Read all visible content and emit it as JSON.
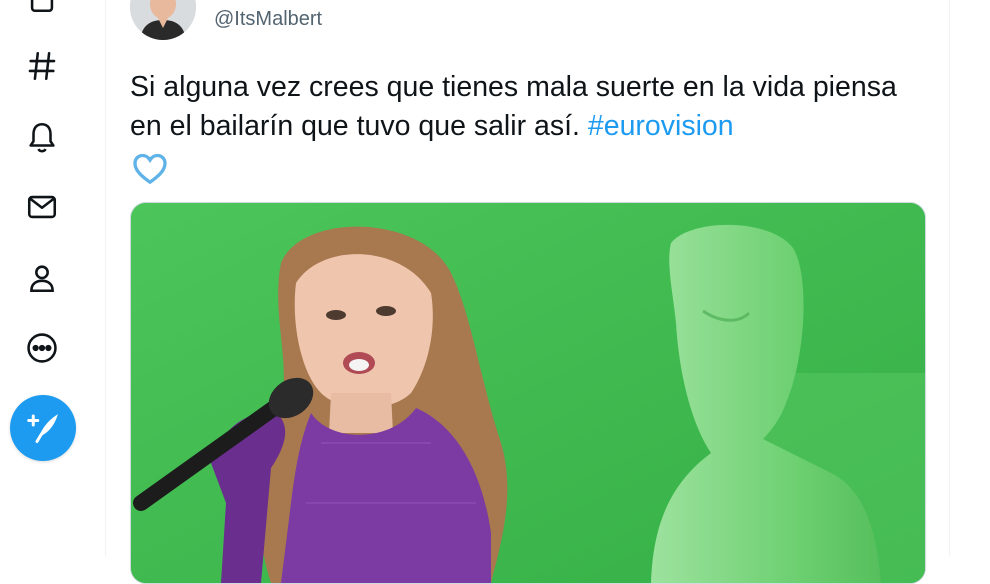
{
  "sidebar": {
    "icons": [
      "bookmark-icon",
      "explore-hashtag-icon",
      "notifications-bell-icon",
      "messages-mail-icon",
      "profile-person-icon",
      "more-dots-icon"
    ],
    "compose_icon": "compose-feather-icon"
  },
  "tweet": {
    "handle": "@ItsMalbert",
    "text": "Si alguna vez crees que tienes mala suerte en la vida piensa en el bailarín que tuvo que salir así. ",
    "hashtag": "#eurovision",
    "emoji": "blue-heart-icon"
  },
  "colors": {
    "accent": "#1d9bf0",
    "text": "#0f1419",
    "secondary": "#536471",
    "screen_green": "#3fbf4a"
  }
}
